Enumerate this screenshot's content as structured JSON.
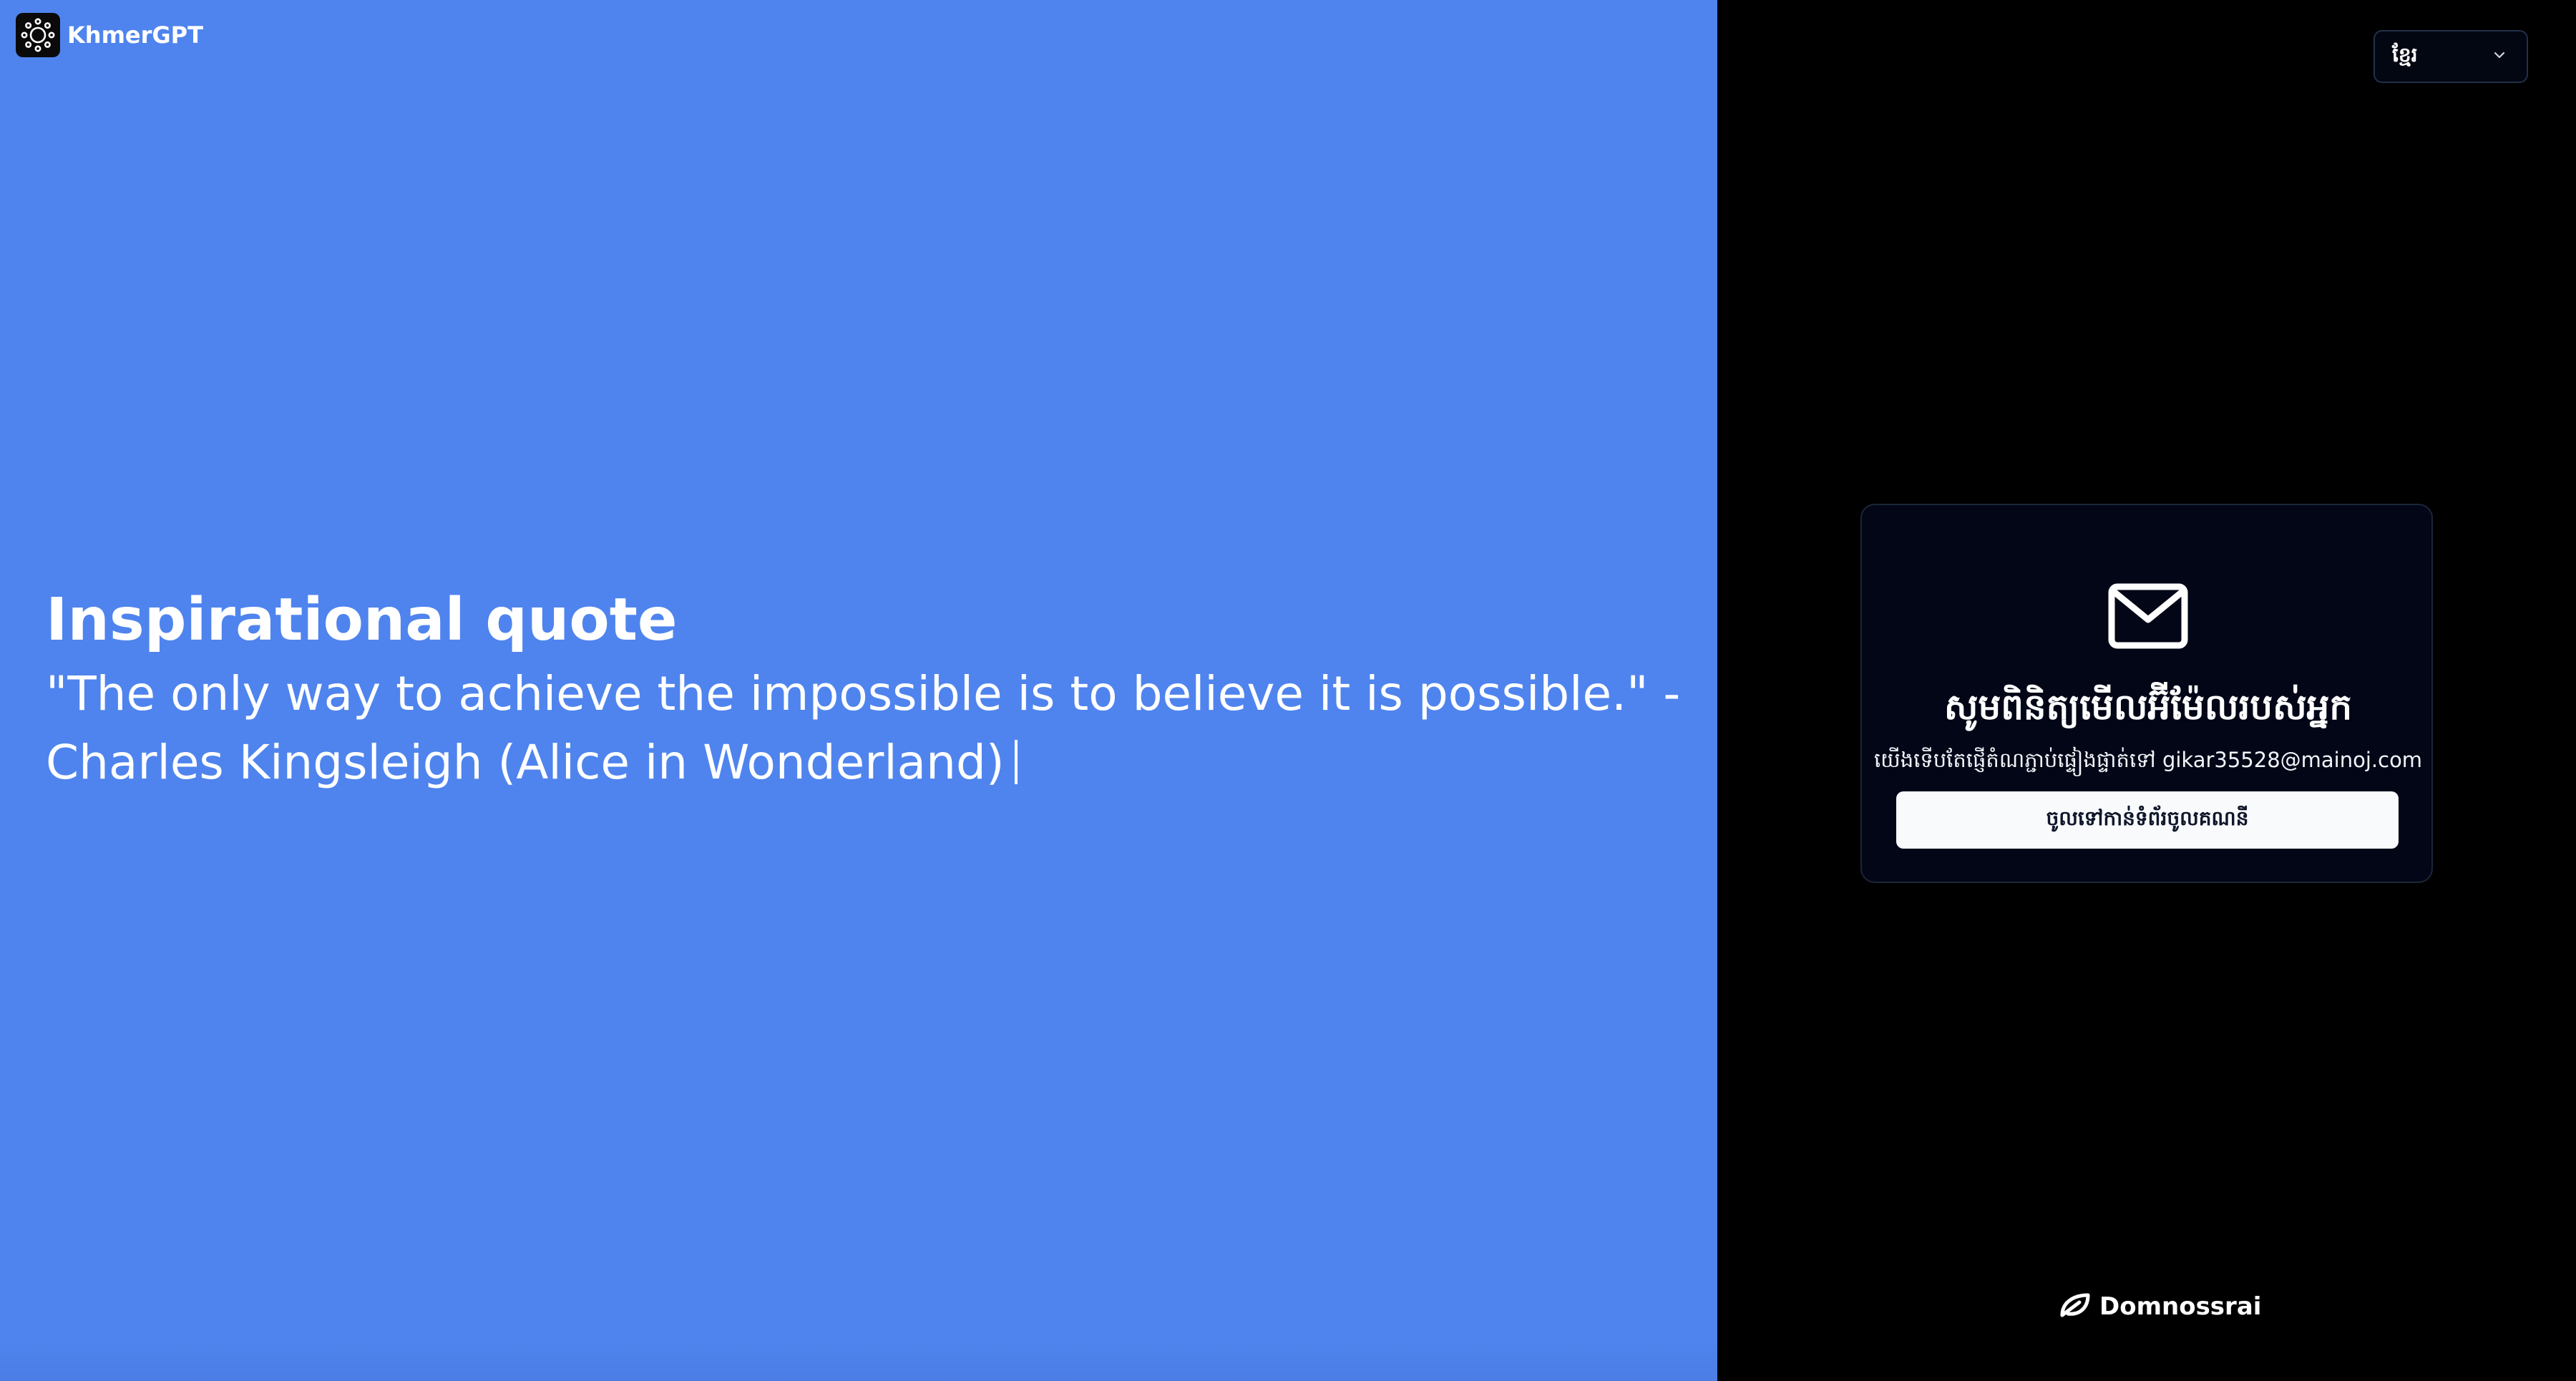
{
  "brand": {
    "name": "KhmerGPT",
    "logo_icon": "aperture-logo-icon"
  },
  "quote": {
    "heading": "Inspirational quote",
    "text": "\"The only way to achieve the impossible is to believe it is possible.\" - Charles Kingsleigh (Alice in Wonderland)"
  },
  "language_select": {
    "selected": "ខ្មែរ",
    "icon": "chevron-down-icon"
  },
  "verify_card": {
    "icon": "mail-icon",
    "title": "សូមពិនិត្យមើលអ៊ីម៉ែលរបស់អ្នក",
    "subtitle": "យើងទើបតែផ្ញើតំណភ្ជាប់ផ្ទៀងផ្ទាត់ទៅ gikar35528@mainoj.com",
    "button_label": "ចូលទៅកាន់ទំព័រចូលគណនី"
  },
  "footer": {
    "brand_name": "Domnossrai",
    "brand_icon": "leaf-logo-icon"
  },
  "colors": {
    "left_panel_bg": "#4f84ee",
    "right_panel_bg": "#000000",
    "card_bg": "#020617",
    "button_bg": "#f8fafc"
  }
}
